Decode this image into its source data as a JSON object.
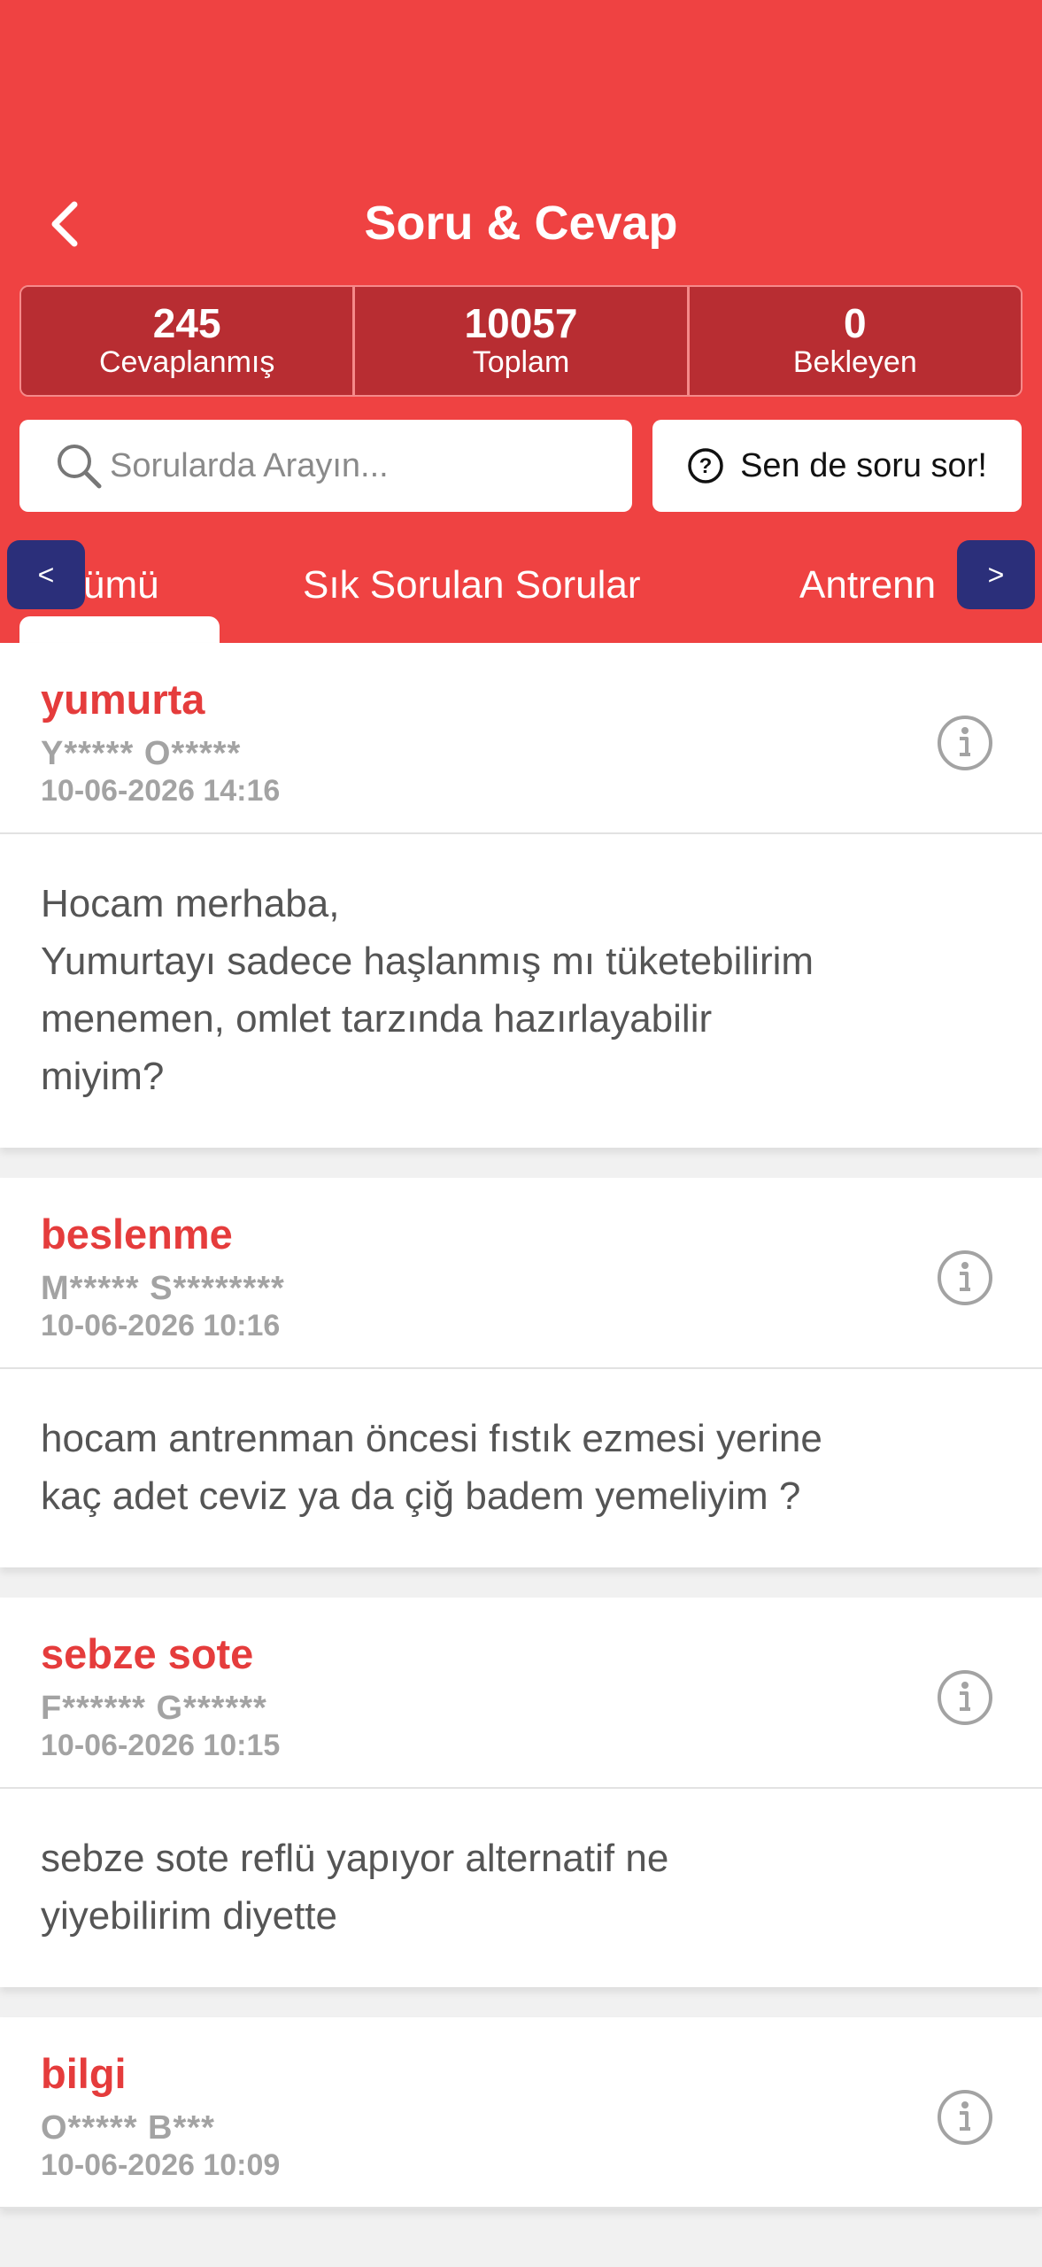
{
  "header": {
    "title": "Soru & Cevap",
    "back_icon": "chevron-left-icon",
    "background": "#ef4242"
  },
  "stats": [
    {
      "value": "245",
      "label": "Cevaplanmış"
    },
    {
      "value": "10057",
      "label": "Toplam"
    },
    {
      "value": "0",
      "label": "Bekleyen"
    }
  ],
  "search": {
    "placeholder": "Sorularda Arayın...",
    "value": "",
    "icon": "search-icon"
  },
  "ask_button": {
    "label": "Sen de soru sor!",
    "icon": "question-circle-icon"
  },
  "tabs": {
    "items": [
      {
        "label": "Tümü",
        "visible_text": "ümü",
        "active": true
      },
      {
        "label": "Sık Sorulan Sorular",
        "active": false
      },
      {
        "label": "Antrenman",
        "visible_text": "Antrenn",
        "active": false
      }
    ],
    "prev_label": "<",
    "next_label": ">"
  },
  "questions": [
    {
      "title": "yumurta",
      "user": "Y***** O*****",
      "date": "10-06-2026 14:16",
      "lines": [
        "Hocam merhaba,",
        "Yumurtayı sadece haşlanmış mı tüketebilirim",
        "menemen, omlet tarzında hazırlayabilir",
        "miyim?"
      ]
    },
    {
      "title": "beslenme",
      "user": "M***** S********",
      "date": "10-06-2026 10:16",
      "lines": [
        "hocam antrenman öncesi fıstık ezmesi yerine",
        "kaç adet ceviz ya da çiğ badem yemeliyim ?"
      ]
    },
    {
      "title": "sebze sote",
      "user": "F****** G******",
      "date": "10-06-2026 10:15",
      "lines": [
        "sebze sote reflü yapıyor alternatif ne",
        "yiyebilirim diyette"
      ]
    },
    {
      "title": "bilgi",
      "user": "O***** B***",
      "date": "10-06-2026 10:09",
      "lines": []
    }
  ]
}
